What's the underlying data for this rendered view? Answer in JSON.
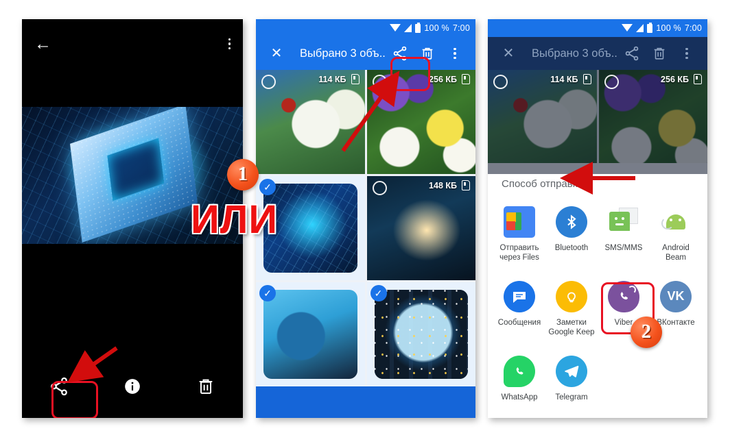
{
  "annotations": {
    "or_text": "ИЛИ",
    "step1": "1",
    "step2": "2"
  },
  "panel1": {
    "name": "photo-viewer",
    "toolbar": {
      "back_icon": "arrow-back-icon",
      "overflow_icon": "more-vert-icon"
    },
    "bottom_actions": [
      {
        "name": "share",
        "icon": "share-icon",
        "highlighted": true
      },
      {
        "name": "info",
        "icon": "info-icon",
        "highlighted": false
      },
      {
        "name": "delete",
        "icon": "trash-icon",
        "highlighted": false
      }
    ]
  },
  "panel2": {
    "name": "file-manager-selection",
    "statusbar": {
      "battery": "100 %",
      "clock": "7:00"
    },
    "appbar": {
      "close_icon": "close-icon",
      "title": "Выбрано 3 объ...",
      "share_icon": "share-icon",
      "delete_icon": "trash-icon",
      "overflow_icon": "more-vert-icon"
    },
    "photos": [
      {
        "size": "114 КБ",
        "storage": "sd-card-icon",
        "selected": false,
        "img": "img-ladybug"
      },
      {
        "size": "256 КБ",
        "storage": "sd-card-icon",
        "selected": false,
        "img": "img-crocus"
      },
      {
        "size": "",
        "storage": "",
        "selected": true,
        "img": "img-chip"
      },
      {
        "size": "148 КБ",
        "storage": "sd-card-icon",
        "selected": false,
        "img": "img-hands"
      },
      {
        "size": "",
        "storage": "",
        "selected": true,
        "img": "img-laptop"
      },
      {
        "size": "",
        "storage": "",
        "selected": true,
        "img": "img-globe"
      }
    ]
  },
  "panel3": {
    "name": "share-sheet",
    "statusbar": {
      "battery": "100 %",
      "clock": "7:00"
    },
    "appbar": {
      "close_icon": "close-icon",
      "title": "Выбрано 3 объ...",
      "share_icon": "share-icon",
      "delete_icon": "trash-icon",
      "overflow_icon": "more-vert-icon"
    },
    "photos": [
      {
        "size": "114 КБ",
        "storage": "sd-card-icon",
        "img": "img-ladybug"
      },
      {
        "size": "256 КБ",
        "storage": "sd-card-icon",
        "img": "img-crocus"
      }
    ],
    "sheet_title": "Способ отправки",
    "apps": [
      {
        "label": "Отправить через Files",
        "icon": "google-files-icon"
      },
      {
        "label": "Bluetooth",
        "icon": "bluetooth-icon"
      },
      {
        "label": "SMS/MMS",
        "icon": "sms-mms-icon"
      },
      {
        "label": "Android Beam",
        "icon": "android-beam-icon"
      },
      {
        "label": "Сообщения",
        "icon": "google-messages-icon"
      },
      {
        "label": "Заметки Google Keep",
        "icon": "google-keep-icon"
      },
      {
        "label": "Viber",
        "icon": "viber-icon"
      },
      {
        "label": "ВКонтакте",
        "icon": "vk-icon"
      },
      {
        "label": "WhatsApp",
        "icon": "whatsapp-icon"
      },
      {
        "label": "Telegram",
        "icon": "telegram-icon"
      }
    ]
  },
  "colors": {
    "accent_blue": "#1a73e8",
    "annotation_red": "#e81123",
    "badge_orange": "#f4521c",
    "viber_purple": "#7b519d"
  }
}
